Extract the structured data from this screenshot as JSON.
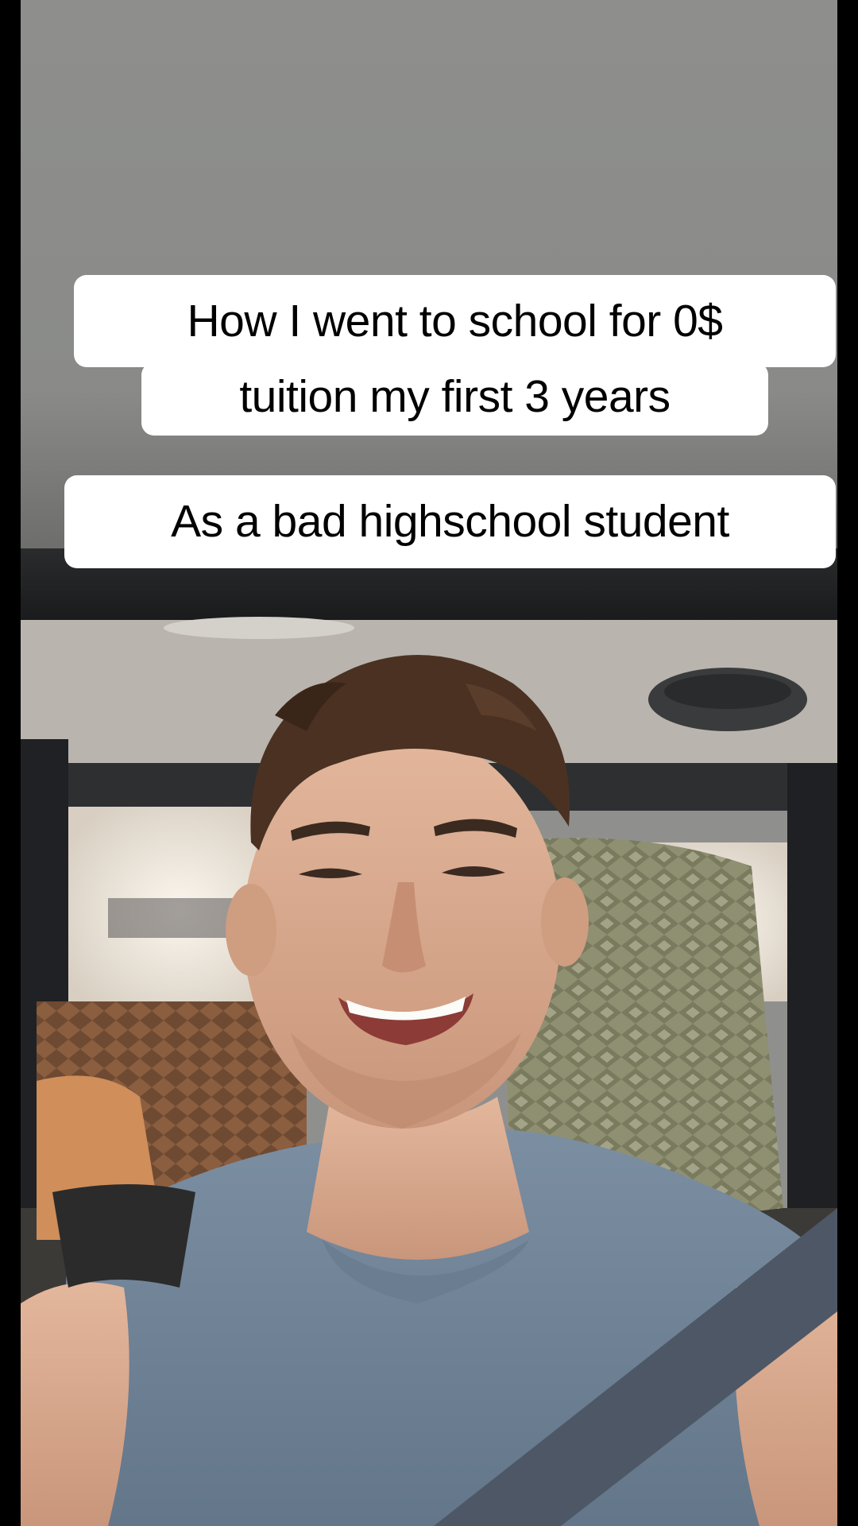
{
  "caption_overlay": {
    "line_1": "How I went to school for 0$",
    "line_2": "tuition my first 3 years",
    "line_3": "As a bad highschool student"
  },
  "scene": {
    "subject": "smiling-young-man-in-car-selfie",
    "colors": {
      "headliner": "#8f908e",
      "caption_bg": "#ffffff",
      "caption_text": "#000000",
      "shirt": "#6f8397",
      "skin": "#d9a98c",
      "hair": "#4a3122",
      "seat": "#8a8a6a",
      "window_light": "#f4efe6"
    }
  }
}
